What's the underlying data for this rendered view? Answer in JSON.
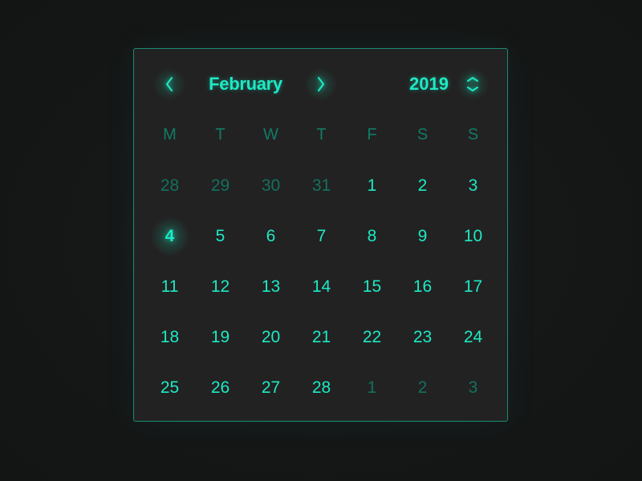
{
  "header": {
    "month": "February",
    "year": "2019",
    "prev_icon": "chevron-left-icon",
    "next_icon": "chevron-right-icon",
    "year_toggle_icon": "chevron-up-down-icon"
  },
  "weekdays": [
    "M",
    "T",
    "W",
    "T",
    "F",
    "S",
    "S"
  ],
  "weeks": [
    [
      {
        "day": "28",
        "muted": true
      },
      {
        "day": "29",
        "muted": true
      },
      {
        "day": "30",
        "muted": true
      },
      {
        "day": "31",
        "muted": true
      },
      {
        "day": "1"
      },
      {
        "day": "2"
      },
      {
        "day": "3"
      }
    ],
    [
      {
        "day": "4",
        "today": true
      },
      {
        "day": "5"
      },
      {
        "day": "6"
      },
      {
        "day": "7"
      },
      {
        "day": "8"
      },
      {
        "day": "9"
      },
      {
        "day": "10"
      }
    ],
    [
      {
        "day": "11"
      },
      {
        "day": "12"
      },
      {
        "day": "13"
      },
      {
        "day": "14"
      },
      {
        "day": "15"
      },
      {
        "day": "16"
      },
      {
        "day": "17"
      }
    ],
    [
      {
        "day": "18"
      },
      {
        "day": "19"
      },
      {
        "day": "20"
      },
      {
        "day": "21"
      },
      {
        "day": "22"
      },
      {
        "day": "23"
      },
      {
        "day": "24"
      }
    ],
    [
      {
        "day": "25"
      },
      {
        "day": "26"
      },
      {
        "day": "27"
      },
      {
        "day": "28"
      },
      {
        "day": "1",
        "muted": true
      },
      {
        "day": "2",
        "muted": true
      },
      {
        "day": "3",
        "muted": true
      }
    ]
  ],
  "colors": {
    "accent": "#1de9c4",
    "muted": "#14705e",
    "panel": "#222222",
    "border": "#1a8c74"
  }
}
